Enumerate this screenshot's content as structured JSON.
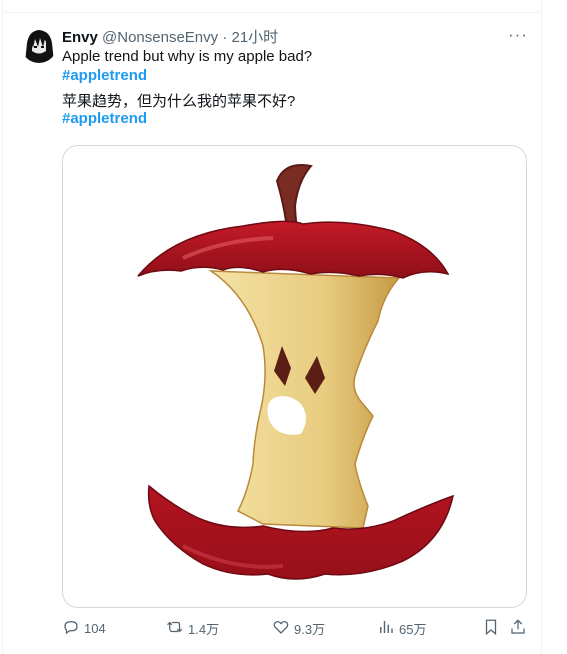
{
  "tweet": {
    "display_name": "Envy",
    "handle": "@NonsenseEnvy",
    "separator": "·",
    "time": "21小时",
    "more_label": "···",
    "text_en": "Apple trend but why is my apple bad?",
    "hashtag_1": "#appletrend",
    "text_zh": "苹果趋势，但为什么我的苹果不好?",
    "hashtag_2": "#appletrend"
  },
  "actions": {
    "replies": "104",
    "retweets": "1.4万",
    "likes": "9.3万",
    "views": "65万"
  },
  "icons": {
    "reply": "speech-bubble-icon",
    "retweet": "retweet-arrows-icon",
    "like": "heart-icon",
    "views": "bar-chart-icon",
    "bookmark": "bookmark-icon",
    "share": "share-upload-icon"
  },
  "colors": {
    "hashtag": "#1d9bf0",
    "secondary_text": "#536471",
    "apple_red": "#a8141f",
    "apple_flesh": "#ecd28c"
  }
}
